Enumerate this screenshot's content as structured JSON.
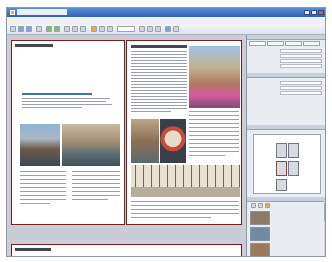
{
  "window": {
    "title": "",
    "accent": "#2f63b5"
  },
  "menubar": {
    "items": [
      "",
      "",
      "",
      "",
      "",
      "",
      "",
      ""
    ]
  },
  "toolbar": {
    "zoom": ""
  },
  "document": {
    "left_page": {
      "photos": [
        "gondola",
        "canal"
      ]
    },
    "right_page": {
      "photos": [
        "bridge",
        "mask",
        "church",
        "palace"
      ]
    }
  },
  "panel": {
    "sections": [
      "",
      "",
      ""
    ],
    "tabs": [
      "",
      "",
      "",
      ""
    ],
    "properties": [
      {
        "label": "",
        "value": ""
      },
      {
        "label": "",
        "value": ""
      },
      {
        "label": "",
        "value": ""
      },
      {
        "label": "",
        "value": ""
      },
      {
        "label": "",
        "value": ""
      },
      {
        "label": "",
        "value": ""
      },
      {
        "label": "",
        "value": ""
      }
    ],
    "thumbnails": [
      {
        "label": "",
        "color": "#8d7b6a"
      },
      {
        "label": "",
        "color": "#6f8aa3"
      },
      {
        "label": "",
        "color": "#9b7a5c"
      },
      {
        "label": "",
        "color": "#7d8f6a"
      }
    ]
  },
  "icons": [
    "new-icon",
    "open-icon",
    "save-icon",
    "print-icon",
    "undo-icon",
    "redo-icon",
    "zoom-icon",
    "layout-icon",
    "image-icon",
    "text-icon",
    "help-icon"
  ]
}
